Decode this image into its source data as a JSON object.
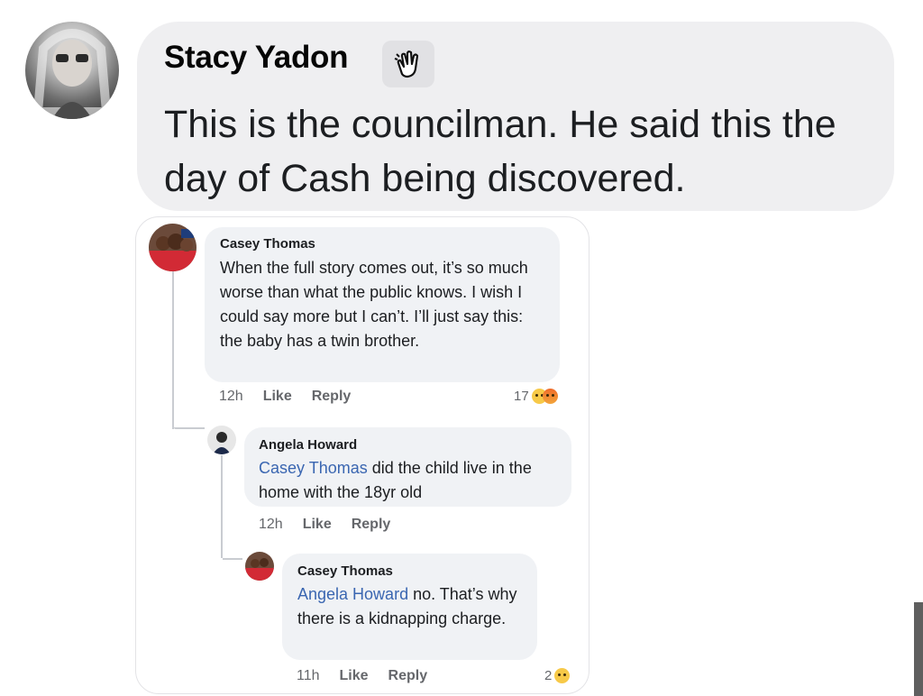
{
  "post": {
    "author": "Stacy Yadon",
    "badge_icon": "waving-hand-icon",
    "text": "This is the councilman. He said this the day of Cash being discovered."
  },
  "screenshot": {
    "comments": [
      {
        "author": "Casey Thomas",
        "text": "When the full story comes out, it’s so much worse than what the public knows. I wish I could say more but I can’t. I’ll just say this: the baby has a twin brother.",
        "time": "12h",
        "like": "Like",
        "reply": "Reply",
        "reaction_count": "17"
      },
      {
        "author": "Angela Howard",
        "mention": "Casey Thomas",
        "text": " did the child live in the home with the 18yr old",
        "time": "12h",
        "like": "Like",
        "reply": "Reply"
      },
      {
        "author": "Casey Thomas",
        "mention": "Angela Howard",
        "text": " no. That’s why there is a kidnapping charge.",
        "time": "11h",
        "like": "Like",
        "reply": "Reply",
        "reaction_count": "2"
      }
    ]
  },
  "colors": {
    "bubble": "#efeff1",
    "mention": "#3a66b1",
    "meta": "#65676b"
  }
}
